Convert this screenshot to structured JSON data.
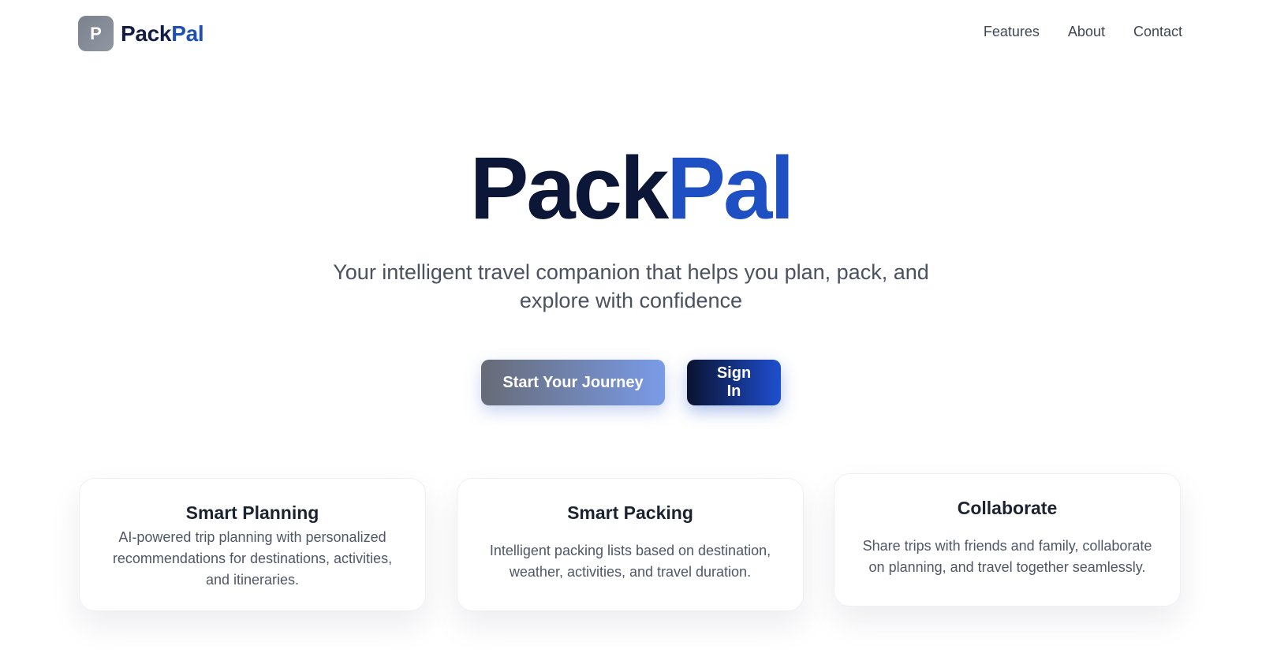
{
  "header": {
    "logo_letter": "P",
    "brand_part1": "Pack",
    "brand_part2": "Pal",
    "nav": [
      {
        "label": "Features"
      },
      {
        "label": "About"
      },
      {
        "label": "Contact"
      }
    ]
  },
  "hero": {
    "title_part1": "Pack",
    "title_part2": "Pal",
    "subtitle": "Your intelligent travel companion that helps you plan, pack, and explore with confidence",
    "primary_cta": "Start Your Journey",
    "secondary_cta": "Sign In"
  },
  "features": [
    {
      "title": "Smart Planning",
      "description": "AI-powered trip planning with personalized recommendations for destinations, activities, and itineraries."
    },
    {
      "title": "Smart Packing",
      "description": "Intelligent packing lists based on destination, weather, activities, and travel duration."
    },
    {
      "title": "Collaborate",
      "description": "Share trips with friends and family, collaborate on planning, and travel together seamlessly."
    }
  ],
  "colors": {
    "brand_dark": "#0c1738",
    "brand_blue": "#1f50c3",
    "text_muted": "#4a5160"
  }
}
